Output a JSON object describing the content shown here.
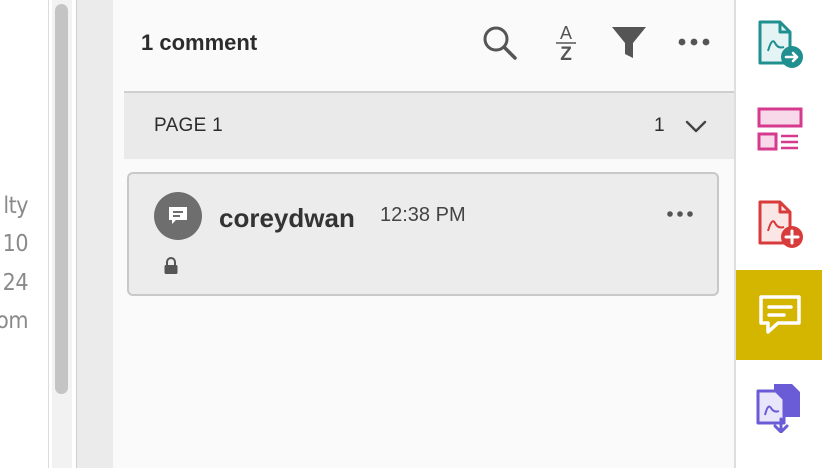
{
  "document": {
    "visible_text_fragments": [
      "lty",
      "10",
      "24",
      "om"
    ]
  },
  "comments_panel": {
    "title": "1 comment",
    "toolbar": {
      "search_icon": "search-icon",
      "sort_icon": "sort-az-icon",
      "sort_letters": [
        "A",
        "Z"
      ],
      "filter_icon": "filter-icon",
      "more_icon": "more-horizontal-icon"
    },
    "page_group": {
      "label": "PAGE 1",
      "count": "1",
      "toggle_icon": "chevron-down-icon"
    },
    "comments": [
      {
        "author": "coreydwan",
        "time": "12:38 PM",
        "avatar_icon": "comment-bubble-icon",
        "status_icon": "lock-icon",
        "more_icon": "more-horizontal-icon"
      }
    ]
  },
  "right_rail": {
    "tools": [
      {
        "name": "export-pdf-icon",
        "color": "#1f8f8f",
        "active": false
      },
      {
        "name": "organize-pages-icon",
        "color": "#d63a8f",
        "active": false
      },
      {
        "name": "create-pdf-icon",
        "color": "#d93b3b",
        "active": false
      },
      {
        "name": "comment-icon",
        "color": "#ffffff",
        "active": true,
        "active_bg": "#d4b500"
      },
      {
        "name": "combine-files-icon",
        "color": "#6a5bd6",
        "active": false
      }
    ]
  }
}
